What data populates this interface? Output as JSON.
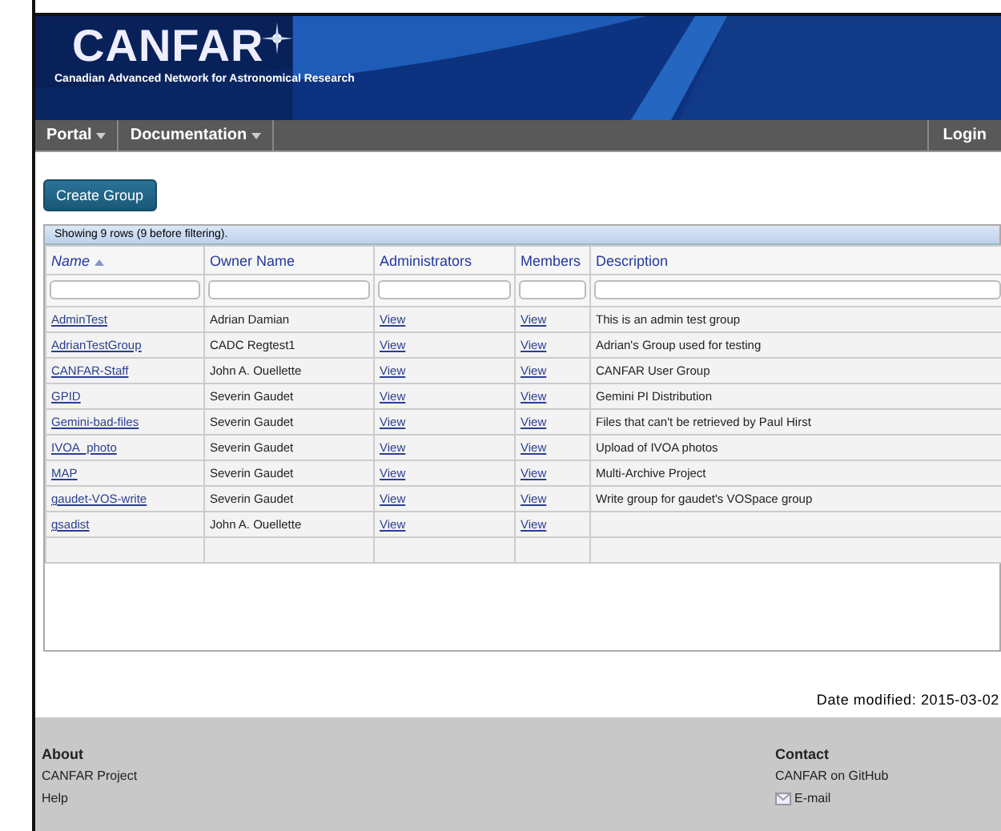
{
  "header": {
    "logo": "CANFAR",
    "tagline": "Canadian Advanced Network for Astronomical Research"
  },
  "nav": {
    "menus": [
      {
        "label": "Portal",
        "dropdown": true
      },
      {
        "label": "Documentation",
        "dropdown": true
      }
    ],
    "login": "Login"
  },
  "create_button": "Create Group",
  "table": {
    "info": "Showing 9 rows (9 before filtering).",
    "columns": [
      {
        "label": "Name",
        "sorted": true
      },
      {
        "label": "Owner Name",
        "sorted": false
      },
      {
        "label": "Administrators",
        "sorted": false
      },
      {
        "label": "Members",
        "sorted": false
      },
      {
        "label": "Description",
        "sorted": false
      }
    ],
    "rows": [
      {
        "name": "AdminTest",
        "owner": "Adrian Damian",
        "administrators": "View",
        "members": "View",
        "description": "This is an admin test group"
      },
      {
        "name": "AdrianTestGroup",
        "owner": "CADC Regtest1",
        "administrators": "View",
        "members": "View",
        "description": "Adrian's Group used for testing"
      },
      {
        "name": "CANFAR-Staff",
        "owner": "John A. Ouellette",
        "administrators": "View",
        "members": "View",
        "description": "CANFAR User Group"
      },
      {
        "name": "GPID",
        "owner": "Severin Gaudet",
        "administrators": "View",
        "members": "View",
        "description": "Gemini PI Distribution"
      },
      {
        "name": "Gemini-bad-files",
        "owner": "Severin Gaudet",
        "administrators": "View",
        "members": "View",
        "description": "Files that can't be retrieved by Paul Hirst"
      },
      {
        "name": "IVOA_photo",
        "owner": "Severin Gaudet",
        "administrators": "View",
        "members": "View",
        "description": "Upload of IVOA photos"
      },
      {
        "name": "MAP",
        "owner": "Severin Gaudet",
        "administrators": "View",
        "members": "View",
        "description": "Multi-Archive Project"
      },
      {
        "name": "gaudet-VOS-write",
        "owner": "Severin Gaudet",
        "administrators": "View",
        "members": "View",
        "description": "Write group for gaudet's VOSpace group"
      },
      {
        "name": "gsadist",
        "owner": "John A. Ouellette",
        "administrators": "View",
        "members": "View"
      }
    ]
  },
  "date_modified": "Date modified: 2015-03-02",
  "footer": {
    "about": {
      "title": "About",
      "links": [
        "CANFAR Project",
        "Help"
      ]
    },
    "contact": {
      "title": "Contact",
      "github": "CANFAR on GitHub",
      "email": "E-mail"
    }
  }
}
